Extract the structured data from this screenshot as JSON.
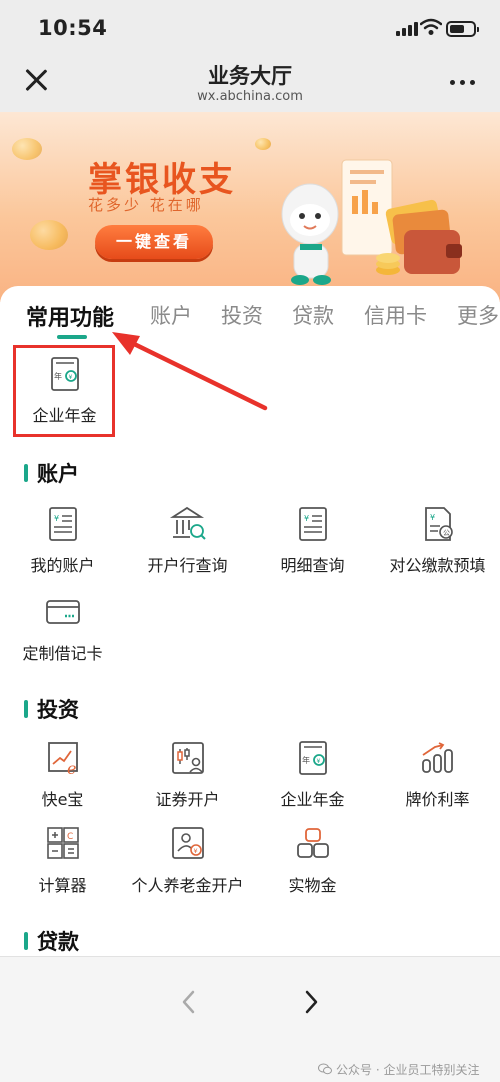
{
  "status_bar": {
    "time": "10:54"
  },
  "nav": {
    "title": "业务大厅",
    "url": "wx.abchina.com"
  },
  "banner": {
    "title": "掌银收支",
    "subtitle": "花多少 花在哪",
    "button_label": "一键查看"
  },
  "tabs": [
    {
      "label": "常用功能",
      "active": true
    },
    {
      "label": "账户"
    },
    {
      "label": "投资"
    },
    {
      "label": "贷款"
    },
    {
      "label": "信用卡"
    },
    {
      "label": "更多"
    }
  ],
  "common": [
    {
      "label": "企业年金",
      "icon": "pension-icon"
    }
  ],
  "sections": {
    "account": {
      "title": "账户",
      "items": [
        {
          "label": "我的账户",
          "icon": "bill-icon"
        },
        {
          "label": "开户行查询",
          "icon": "bank-search-icon"
        },
        {
          "label": "明细查询",
          "icon": "detail-icon"
        },
        {
          "label": "对公缴款预填",
          "icon": "payment-form-icon"
        },
        {
          "label": "定制借记卡",
          "icon": "card-icon"
        }
      ]
    },
    "invest": {
      "title": "投资",
      "items": [
        {
          "label": "快e宝",
          "icon": "kuaie-icon"
        },
        {
          "label": "证券开户",
          "icon": "securities-icon"
        },
        {
          "label": "企业年金",
          "icon": "pension-icon"
        },
        {
          "label": "牌价利率",
          "icon": "rate-chart-icon"
        },
        {
          "label": "计算器",
          "icon": "calculator-icon"
        },
        {
          "label": "个人养老金开户",
          "icon": "personal-pension-icon"
        },
        {
          "label": "实物金",
          "icon": "gold-bar-icon"
        }
      ]
    },
    "loan": {
      "title": "贷款"
    }
  },
  "watermark": "公众号 · 企业员工特别关注",
  "colors": {
    "accent": "#1ba78a",
    "highlight": "#e8322b",
    "banner_text": "#e8551f"
  }
}
